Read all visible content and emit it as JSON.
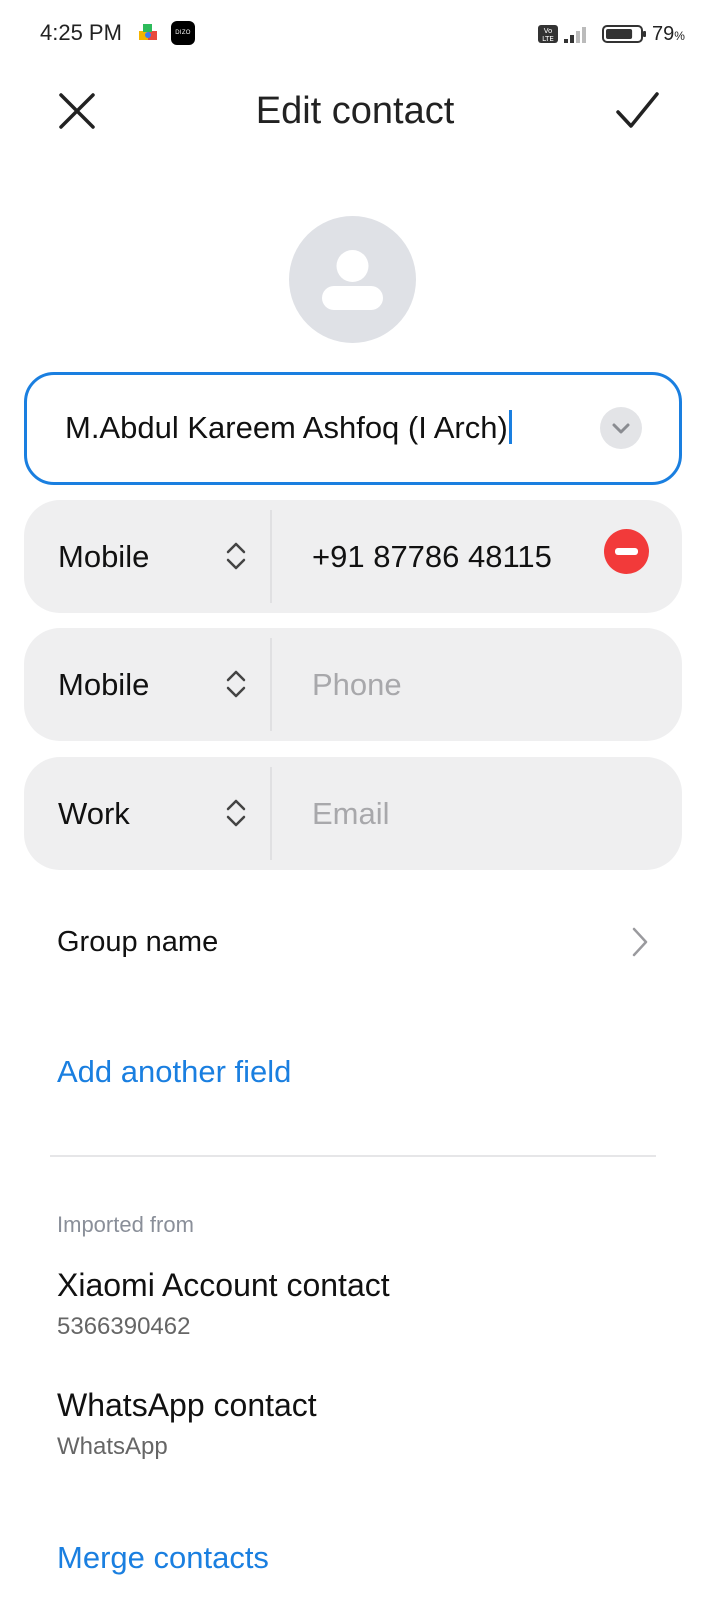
{
  "status_bar": {
    "time": "4:25 PM",
    "app_icon_2_label": "DIZO",
    "volte": "Vo LTE",
    "battery_percent": "79",
    "battery_pct_symbol": "%",
    "battery_level": 0.79
  },
  "header": {
    "title": "Edit contact",
    "close_icon": "close-icon",
    "save_icon": "check-icon"
  },
  "name_field": {
    "value": "M.Abdul Kareem Ashfoq (I Arch)"
  },
  "fields": [
    {
      "type": "Mobile",
      "value": "+91 87786 48115",
      "placeholder": ""
    },
    {
      "type": "Mobile",
      "value": "",
      "placeholder": "Phone"
    },
    {
      "type": "Work",
      "value": "",
      "placeholder": "Email"
    }
  ],
  "group": {
    "label": "Group name"
  },
  "add_field": {
    "label": "Add another field"
  },
  "imported": {
    "label": "Imported from",
    "accounts": [
      {
        "title": "Xiaomi Account contact",
        "subtitle": "5366390462"
      },
      {
        "title": "WhatsApp contact",
        "subtitle": "WhatsApp"
      }
    ]
  },
  "merge": {
    "label": "Merge contacts"
  },
  "colors": {
    "accent": "#1a7fe0",
    "remove": "#f23a3a",
    "row_bg": "#efeff0"
  }
}
